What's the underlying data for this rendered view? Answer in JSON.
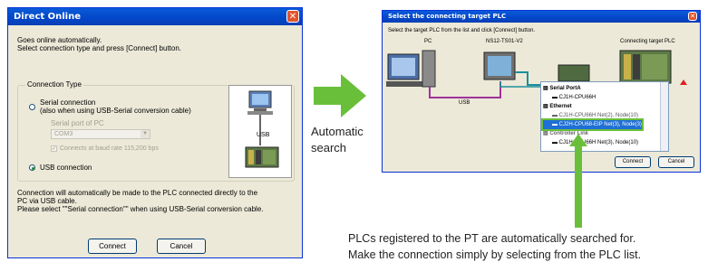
{
  "dialog1": {
    "title": "Direct Online",
    "intro_line1": "Goes online automatically.",
    "intro_line2": "Select connection type and press [Connect] button.",
    "connection_type_label": "Connection Type",
    "serial_label": "Serial connection",
    "serial_sub": "(also when using USB-Serial conversion cable)",
    "serial_port_label": "Serial port of PC",
    "serial_port_value": "COM3",
    "baud_label": "Connects at baud rate 115,200 bps",
    "usb_label": "USB connection",
    "usb_diagram_label": "USB",
    "note_line1": "Connection will automatically be made to the PLC connected directly to the",
    "note_line2": "PC via USB cable.",
    "note_line3": "Please select \"\"Serial connection\"\" when using USB-Serial conversion cable.",
    "connect_label": "Connect",
    "cancel_label": "Cancel",
    "selected_connection": "USB connection"
  },
  "arrow_caption": {
    "line1": "Automatic",
    "line2": "search"
  },
  "dialog2": {
    "title": "Select the connecting target PLC",
    "instruction": "Select the target PLC from the list and click [Connect] button.",
    "pc_label": "PC",
    "pt_label": "NS12-TS01-V2",
    "target_label": "Connecting target PLC",
    "usb_label": "USB",
    "tree": [
      {
        "label": "Serial PortA",
        "level": 0
      },
      {
        "label": "CJ1H-CPU66H",
        "level": 1
      },
      {
        "label": "Ethernet",
        "level": 0
      },
      {
        "label": "CJ1H-CPU66H  Net(2), Node(10)",
        "level": 1
      },
      {
        "label": "CJ2H-CPU68-EIP   Net(3), Node(3)",
        "level": 1,
        "selected": true
      },
      {
        "label": "Controller Link",
        "level": 0
      },
      {
        "label": "CJ1H-CPU66H  Net(3), Node(10)",
        "level": 1
      }
    ],
    "connect_label": "Connect",
    "cancel_label": "Cancel"
  },
  "bottom_caption": {
    "line1": "PLCs registered to the PT are automatically searched for.",
    "line2": "Make the connection simply by selecting from the PLC list."
  },
  "colors": {
    "accent_green": "#6abf3a",
    "titlebar_blue": "#0346c9",
    "selection": "#1f6fd6"
  }
}
